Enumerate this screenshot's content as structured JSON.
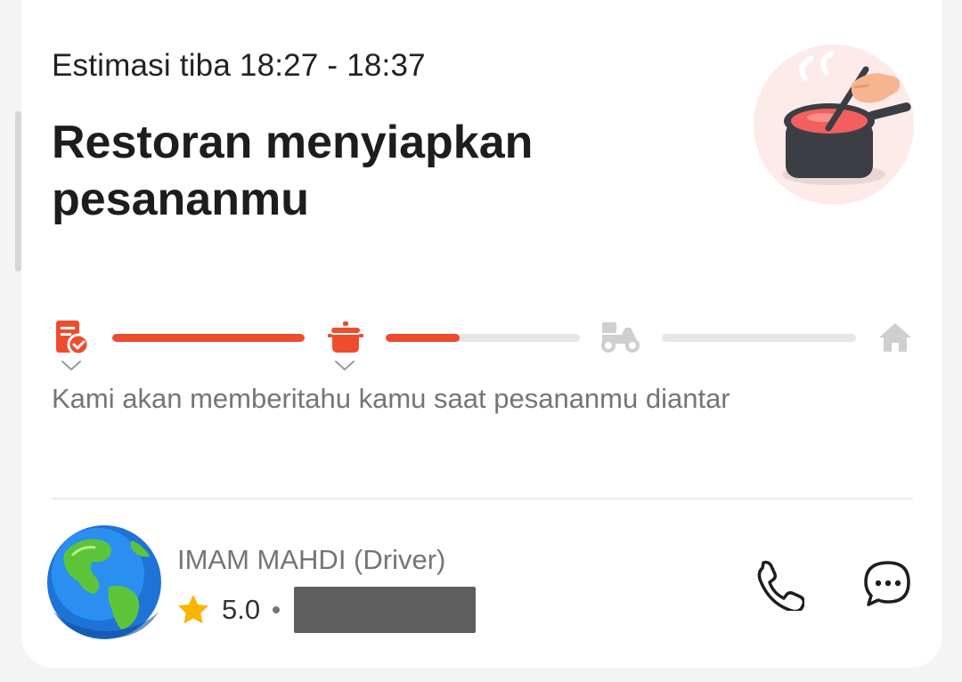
{
  "eta": {
    "label": "Estimasi tiba 18:27 - 18:37"
  },
  "status": {
    "title": "Restoran menyiapkan pesananmu",
    "illustration": "cooking-pot-illustration"
  },
  "tracker": {
    "steps": [
      {
        "icon": "order-confirmed-icon",
        "active": true
      },
      {
        "icon": "cooking-pot-icon",
        "active": true
      },
      {
        "icon": "delivery-scooter-icon",
        "active": false
      },
      {
        "icon": "home-icon",
        "active": false
      }
    ],
    "segments_progress": [
      1.0,
      0.38,
      0.0
    ],
    "active_color": "#ee4d2d",
    "inactive_color": "#cfcfcf"
  },
  "hint": "Kami akan memberitahu kamu saat pesananmu diantar",
  "driver": {
    "name": "IMAM MAHDI (Driver)",
    "rating": "5.0",
    "avatar": "globe-avatar",
    "plate_redacted": true
  },
  "actions": {
    "call_icon": "phone-icon",
    "chat_icon": "chat-bubble-icon"
  }
}
